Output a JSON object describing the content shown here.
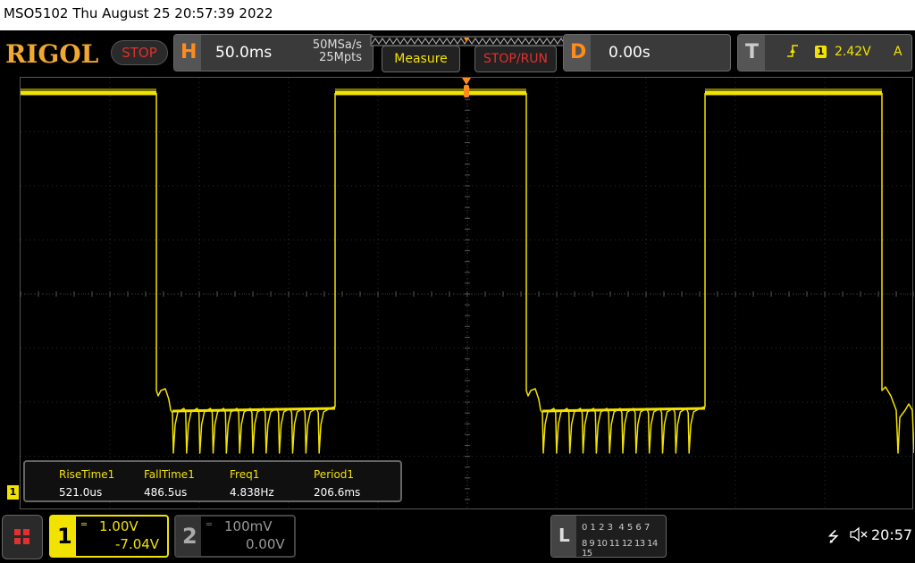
{
  "title_bar": {
    "text": "MSO5102  Thu August 25 20:57:39 2022"
  },
  "top_bar": {
    "logo": "RIGOL",
    "run_state": "STOP",
    "horizontal": {
      "letter": "H",
      "scale": "50.0ms",
      "sample_rate": "50MSa/s",
      "memory_depth": "25Mpts"
    },
    "measure_button": "Measure",
    "stop_run_button": "STOP/RUN",
    "delay": {
      "letter": "D",
      "value": "0.00s"
    },
    "trigger": {
      "letter": "T",
      "channel": "1",
      "level": "2.42V",
      "mode": "A"
    }
  },
  "channel_marker": "1",
  "trace_color": "#f2e200",
  "measurements": [
    {
      "label": "RiseTime1",
      "value": "521.0us"
    },
    {
      "label": "FallTime1",
      "value": "486.5us"
    },
    {
      "label": "Freq1",
      "value": "4.838Hz"
    },
    {
      "label": "Period1",
      "value": "206.6ms"
    }
  ],
  "bottom_bar": {
    "ch1": {
      "number": "1",
      "scale": "1.00V",
      "offset": "-7.04V"
    },
    "ch2": {
      "number": "2",
      "scale": "100mV",
      "offset": "0.00V"
    },
    "logic": {
      "letter": "L",
      "row1": "0 1 2 3  4 5 6 7",
      "row2": "8 9 10 11 12 13 14 15"
    },
    "time": "20:57"
  }
}
